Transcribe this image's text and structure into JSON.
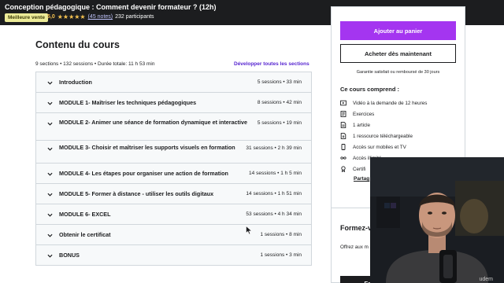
{
  "header": {
    "course_title": "Conception pédagogique : Comment devenir formateur ? (12h)",
    "badge": "Meilleure vente",
    "rating": "5,0",
    "notes": "(45 notes)",
    "participants": "232 participants"
  },
  "content": {
    "title": "Contenu du cours",
    "meta": "9 sections • 132 sessions • Durée totale: 11 h 53 min",
    "expand_all": "Développer toutes les sections",
    "sections": [
      {
        "title": "Introduction",
        "meta": "5 sessions • 33 min"
      },
      {
        "title": "MODULE 1- Maîtriser les techniques pédagogiques",
        "meta": "8 sessions • 42 min"
      },
      {
        "title": "MODULE 2- Animer une séance de formation dynamique et interactive",
        "meta": "5 sessions • 19 min"
      },
      {
        "title": "MODULE 3- Choisir et maîtriser les supports visuels en formation",
        "meta": "31 sessions • 2 h 39 min"
      },
      {
        "title": "MODULE 4- Les étapes pour organiser une action de formation",
        "meta": "14 sessions • 1 h 5 min"
      },
      {
        "title": "MODULE 5- Former à distance - utiliser les outils digitaux",
        "meta": "14 sessions • 1 h 51 min"
      },
      {
        "title": "MODULE 6- EXCEL",
        "meta": "53 sessions • 4 h 34 min"
      },
      {
        "title": "Obtenir le certificat",
        "meta": "1 sessions • 8 min"
      },
      {
        "title": "BONUS",
        "meta": "1 sessions • 3 min"
      }
    ]
  },
  "sidebar": {
    "add_to_cart": "Ajouter au panier",
    "buy_now": "Acheter dès maintenant",
    "guarantee": "Garantie satisfait ou remboursé de 30 jours",
    "includes_title": "Ce cours comprend :",
    "includes": [
      {
        "icon": "video-icon",
        "label": "Vidéo à la demande de 12 heures"
      },
      {
        "icon": "exercise-icon",
        "label": "Exercices"
      },
      {
        "icon": "article-icon",
        "label": "1 article"
      },
      {
        "icon": "download-icon",
        "label": "1 ressource téléchargeable"
      },
      {
        "icon": "mobile-icon",
        "label": "Accès sur mobiles et TV"
      },
      {
        "icon": "infinity-icon",
        "label": "Accès illimité"
      },
      {
        "icon": "certificate-icon",
        "label": "Certifi"
      }
    ],
    "share": "Partag",
    "forme_title": "Formez-v plus ?",
    "forme_text": "Offrez aux m à plus de 22 tout moment",
    "forme_button": "Essayez Udemy Business"
  },
  "webcam": {
    "watermark": "udem"
  },
  "colors": {
    "brand_purple": "#a435f0",
    "link_purple": "#5624d0",
    "dark": "#1c1d1f",
    "star": "#f4c150",
    "badge_bg": "#eceb98"
  }
}
